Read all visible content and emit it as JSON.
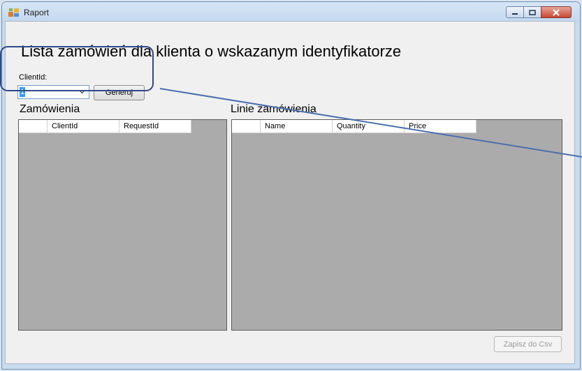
{
  "window": {
    "title": "Raport"
  },
  "form": {
    "heading": "Lista zamówień dla klienta o wskazanym identyfikatorze",
    "client_id_label": "ClientId:",
    "client_id_value": "1",
    "generate_label": "Generuj",
    "export_label": "Zapisz do Csv"
  },
  "orders": {
    "title": "Zamówienia",
    "columns": [
      "",
      "ClientId",
      "RequestId"
    ]
  },
  "order_lines": {
    "title": "Linie zamówienia",
    "columns": [
      "",
      "Name",
      "Quantity",
      "Price"
    ]
  },
  "colors": {
    "grid_background": "#ababab",
    "selection": "#3399ff",
    "highlight_stroke": "#2d4a8a",
    "annotation_line": "#4a6fb0"
  },
  "icons": {
    "app": "app-windows-icon",
    "minimize": "minimize-icon",
    "maximize": "maximize-icon",
    "close": "close-icon",
    "dropdown": "chevron-down-icon"
  }
}
